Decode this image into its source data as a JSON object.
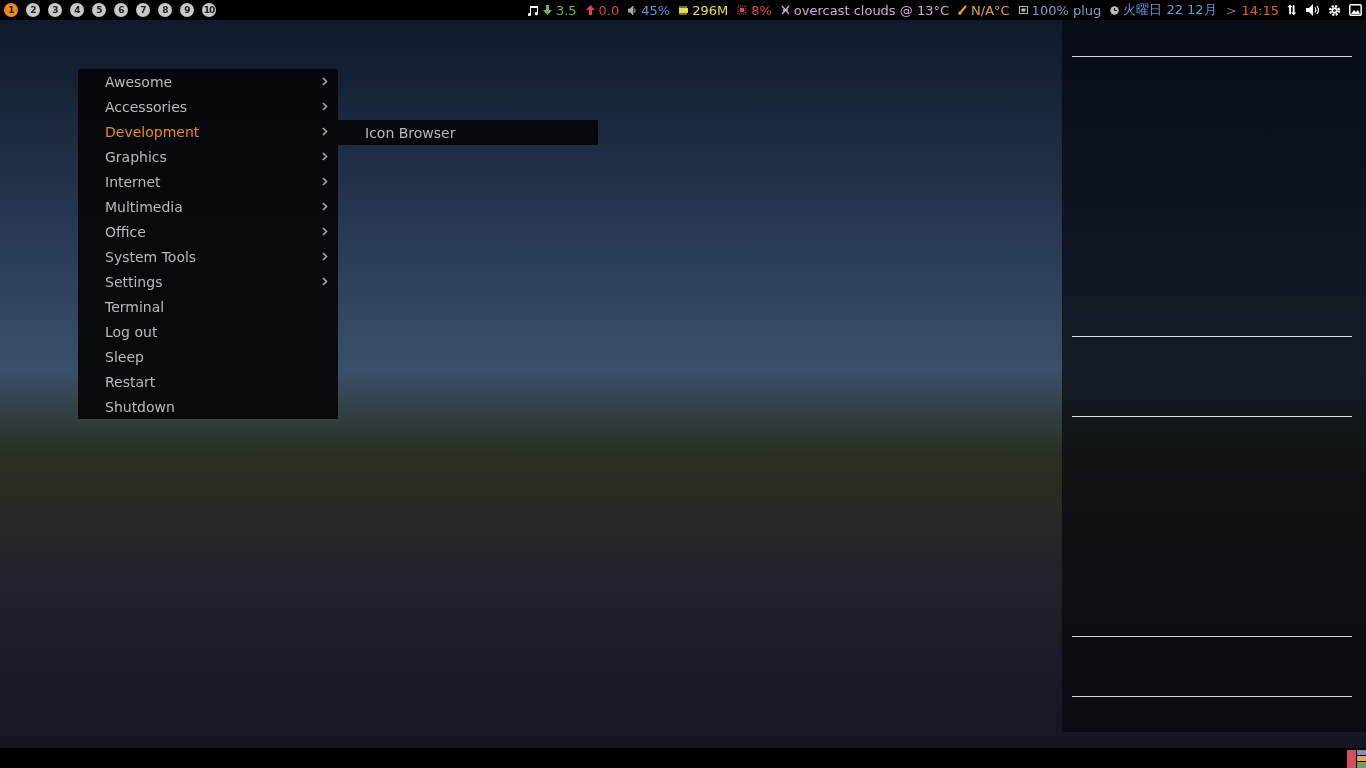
{
  "tags": [
    {
      "label": "1",
      "selected": true
    },
    {
      "label": "2",
      "selected": false
    },
    {
      "label": "3",
      "selected": false
    },
    {
      "label": "4",
      "selected": false
    },
    {
      "label": "5",
      "selected": false
    },
    {
      "label": "6",
      "selected": false
    },
    {
      "label": "7",
      "selected": false
    },
    {
      "label": "8",
      "selected": false
    },
    {
      "label": "9",
      "selected": false
    },
    {
      "label": "10",
      "selected": false
    }
  ],
  "widgets": [
    {
      "kind": "music"
    },
    {
      "kind": "net-down",
      "text": "3.5",
      "color": "#7fb050"
    },
    {
      "kind": "net-up",
      "text": "0.0",
      "color": "#e0405a"
    },
    {
      "kind": "volume",
      "text": "45%",
      "color": "#6f92d8"
    },
    {
      "kind": "memory",
      "text": "296M",
      "color": "#e6e040"
    },
    {
      "kind": "cpu",
      "text": "8%",
      "color": "#e8406a"
    },
    {
      "kind": "weather",
      "text": "overcast clouds @ 13°C",
      "color": "#d0a8d8"
    },
    {
      "kind": "temperature",
      "text": "N/A°C",
      "color": "#e8a040"
    },
    {
      "kind": "battery",
      "text": "100% plug",
      "color": "#8a9ac8"
    },
    {
      "kind": "clock",
      "text": "火曜日 22 12月",
      "color": "#6f92d8"
    },
    {
      "kind": "separator",
      "text": ">",
      "color": "#7a7a7a"
    },
    {
      "kind": "time",
      "text": "14:15",
      "color": "#e8601c"
    }
  ],
  "tray": [
    {
      "kind": "network"
    },
    {
      "kind": "volume"
    },
    {
      "kind": "settings"
    },
    {
      "kind": "screen"
    }
  ],
  "menu": [
    {
      "label": "Awesome",
      "has_submenu": true,
      "selected": false
    },
    {
      "label": "Accessories",
      "has_submenu": true,
      "selected": false
    },
    {
      "label": "Development",
      "has_submenu": true,
      "selected": true,
      "submenu": [
        "Icon Browser"
      ]
    },
    {
      "label": "Graphics",
      "has_submenu": true,
      "selected": false
    },
    {
      "label": "Internet",
      "has_submenu": true,
      "selected": false
    },
    {
      "label": "Multimedia",
      "has_submenu": true,
      "selected": false
    },
    {
      "label": "Office",
      "has_submenu": true,
      "selected": false
    },
    {
      "label": "System Tools",
      "has_submenu": true,
      "selected": false
    },
    {
      "label": "Settings",
      "has_submenu": true,
      "selected": false
    },
    {
      "label": "Terminal",
      "has_submenu": false,
      "selected": false
    },
    {
      "label": "Log out",
      "has_submenu": false,
      "selected": false
    },
    {
      "label": "Sleep",
      "has_submenu": false,
      "selected": false
    },
    {
      "label": "Restart",
      "has_submenu": false,
      "selected": false
    },
    {
      "label": "Shutdown",
      "has_submenu": false,
      "selected": false
    }
  ],
  "layout_indicator": {
    "kind": "tile"
  }
}
